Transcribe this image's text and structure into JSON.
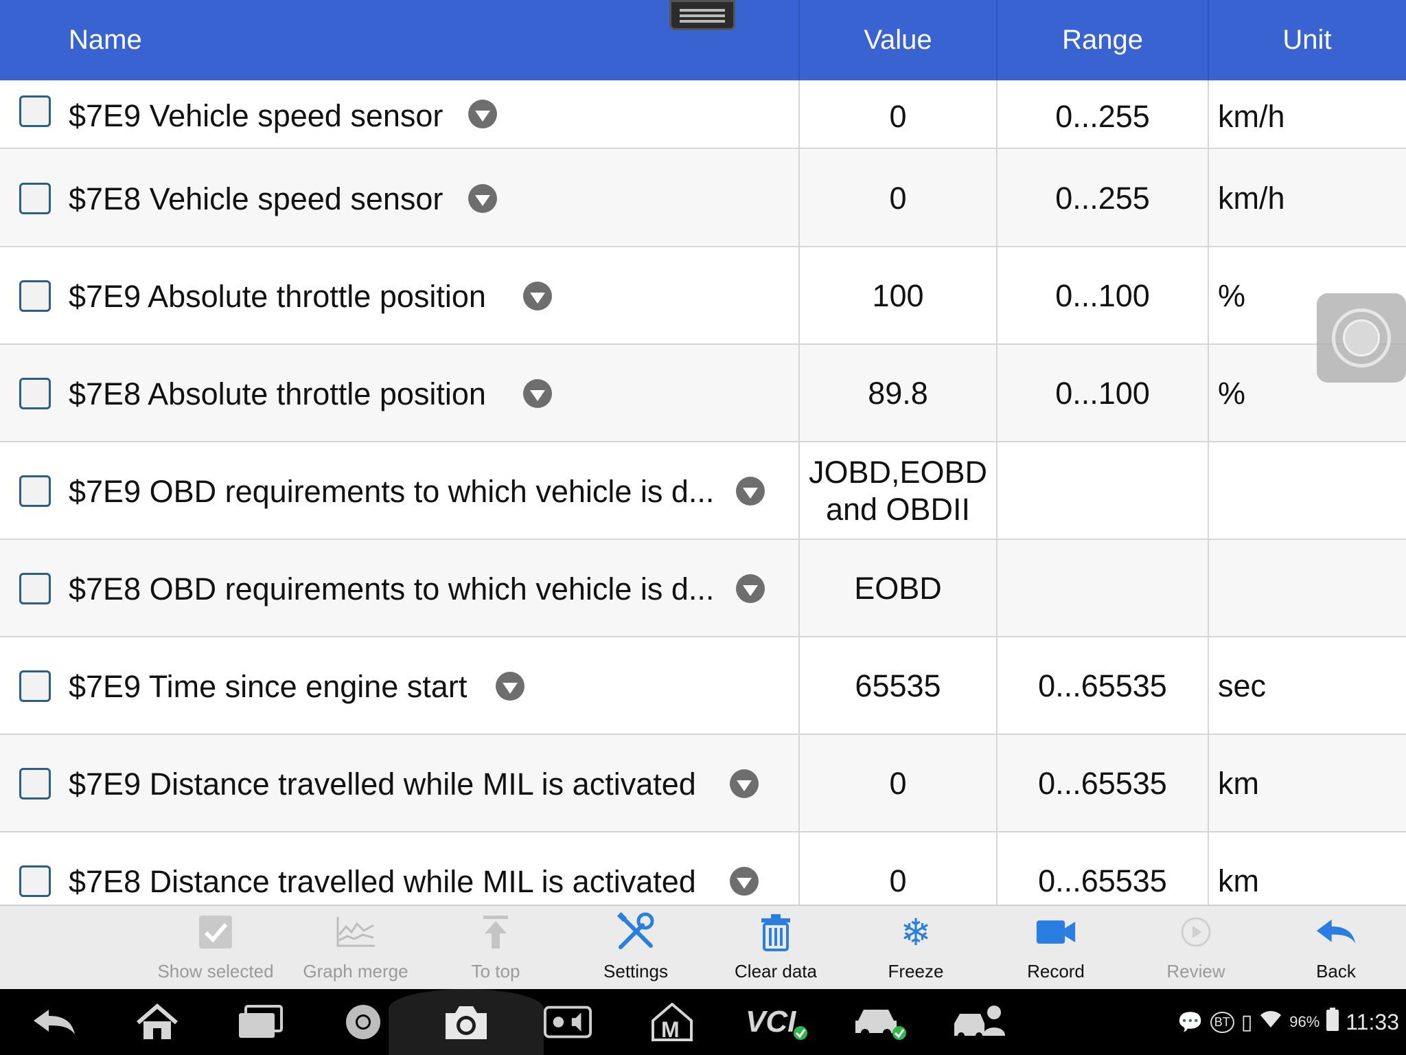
{
  "header": {
    "name": "Name",
    "value": "Value",
    "range": "Range",
    "unit": "Unit"
  },
  "rows": [
    {
      "name": "$7E9 Vehicle speed sensor",
      "value": "0",
      "range": "0...255",
      "unit": "km/h"
    },
    {
      "name": "$7E8 Vehicle speed sensor",
      "value": "0",
      "range": "0...255",
      "unit": "km/h"
    },
    {
      "name": "$7E9 Absolute throttle position",
      "value": "100",
      "range": "0...100",
      "unit": "%"
    },
    {
      "name": "$7E8 Absolute throttle position",
      "value": "89.8",
      "range": "0...100",
      "unit": "%"
    },
    {
      "name": "$7E9 OBD requirements to which vehicle is d...",
      "value": "JOBD,EOBD and OBDII",
      "range": "",
      "unit": ""
    },
    {
      "name": "$7E8 OBD requirements to which vehicle is d...",
      "value": "EOBD",
      "range": "",
      "unit": ""
    },
    {
      "name": "$7E9 Time since engine start",
      "value": "65535",
      "range": "0...65535",
      "unit": "sec"
    },
    {
      "name": "$7E9 Distance travelled while MIL is activated",
      "value": "0",
      "range": "0...65535",
      "unit": "km"
    },
    {
      "name": "$7E8 Distance travelled while MIL is activated",
      "value": "0",
      "range": "0...65535",
      "unit": "km"
    }
  ],
  "toolbar": {
    "show_selected": "Show selected",
    "graph_merge": "Graph merge",
    "to_top": "To top",
    "settings": "Settings",
    "clear_data": "Clear data",
    "freeze": "Freeze",
    "record": "Record",
    "review": "Review",
    "back": "Back"
  },
  "status": {
    "battery": "96%",
    "time": "11:33",
    "bt": "BT"
  },
  "colors": {
    "header": "#3a63d2",
    "accent": "#2a7de1",
    "toolbar": "#ebebeb"
  }
}
